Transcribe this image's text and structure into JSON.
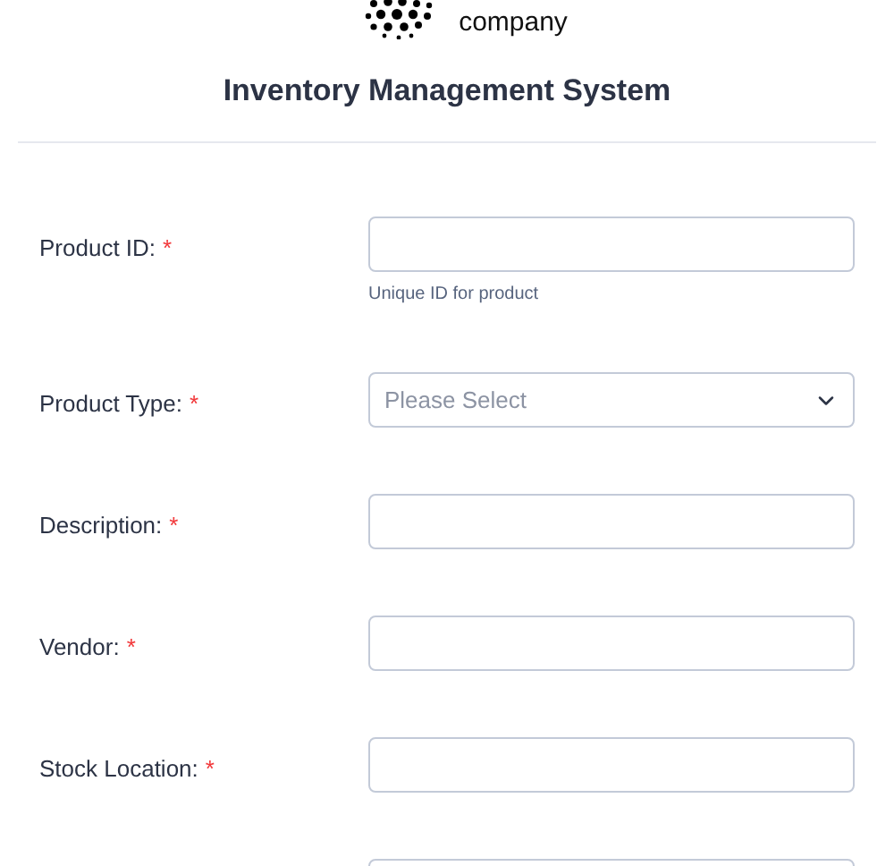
{
  "brand": {
    "name": "company"
  },
  "title": "Inventory Management System",
  "fields": [
    {
      "kind": "text",
      "label": "Product ID:",
      "required_mark": "*",
      "helper": "Unique ID for product"
    },
    {
      "kind": "select",
      "label": "Product Type:",
      "required_mark": "*",
      "placeholder": "Please Select"
    },
    {
      "kind": "text",
      "label": "Description:",
      "required_mark": "*"
    },
    {
      "kind": "text",
      "label": "Vendor:",
      "required_mark": "*"
    },
    {
      "kind": "text",
      "label": "Stock Location:",
      "required_mark": "*"
    }
  ]
}
